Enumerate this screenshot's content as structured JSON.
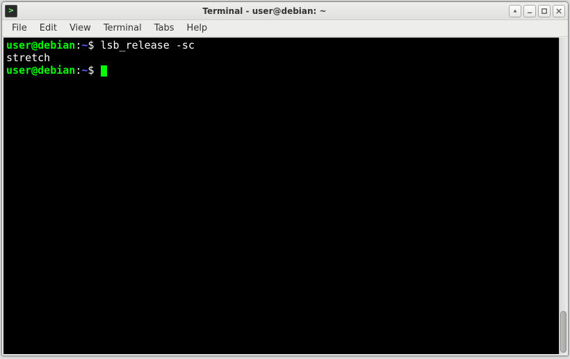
{
  "window": {
    "title": "Terminal - user@debian: ~"
  },
  "menu": {
    "file": "File",
    "edit": "Edit",
    "view": "View",
    "terminal": "Terminal",
    "tabs": "Tabs",
    "help": "Help"
  },
  "terminal": {
    "lines": [
      {
        "prompt": {
          "userhost": "user@debian",
          "sep": ":",
          "path": "~",
          "dollar": "$ "
        },
        "command": "lsb_release -sc"
      },
      {
        "output": "stretch"
      },
      {
        "prompt": {
          "userhost": "user@debian",
          "sep": ":",
          "path": "~",
          "dollar": "$ "
        },
        "cursor": true
      }
    ]
  }
}
